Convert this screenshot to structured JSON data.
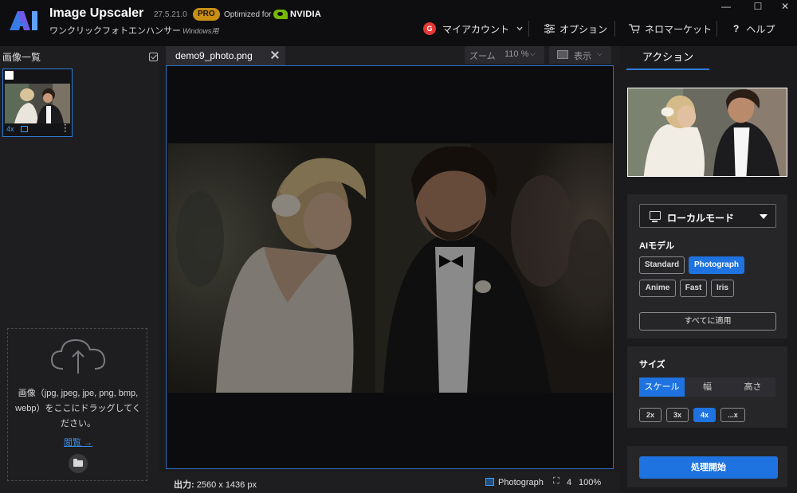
{
  "app": {
    "name": "Image Upscaler",
    "version": "27.5.21.0",
    "badge": "PRO",
    "optimized_for": "Optimized for",
    "optimized_brand": "NVIDIA",
    "subtitle": "ワンクリックフォトエンハンサー",
    "subtitle_os": "Windows用"
  },
  "window_controls": {
    "minimize": "—",
    "maximize": "☐",
    "close": "✕"
  },
  "topnav": {
    "account_initial": "G",
    "account": "マイアカウント",
    "options": "オプション",
    "market": "ネロマーケット",
    "help_glyph": "?",
    "help": "ヘルプ"
  },
  "left_panel": {
    "title": "画像一覧",
    "thumbnail": {
      "scale": "4x"
    },
    "dropzone": {
      "text": "画像（jpg, jpeg, jpe, png, bmp, webp）をここにドラッグしてください。",
      "browse": "閲覧 →"
    }
  },
  "tab": {
    "filename": "demo9_photo.png"
  },
  "zoom": {
    "label": "ズーム",
    "value": "110 %",
    "caret": "⌵"
  },
  "view": {
    "label": "表示",
    "caret": "⌵"
  },
  "status": {
    "output_label": "出力:",
    "output_value": "2560 x 1436 px",
    "model": "Photograph",
    "scale": "4",
    "zoom": "100%"
  },
  "right_panel": {
    "action_tab": "アクション",
    "mode": "ローカルモード",
    "ai_model_label": "AIモデル",
    "models": [
      "Standard",
      "Photograph",
      "Anime",
      "Fast",
      "Iris"
    ],
    "selected_model": "Photograph",
    "apply_all": "すべてに適用",
    "size_label": "サイズ",
    "size_modes": [
      "スケール",
      "幅",
      "高さ"
    ],
    "selected_size_mode": "スケール",
    "scales": [
      "2x",
      "3x",
      "4x",
      "...x"
    ],
    "selected_scale": "4x",
    "process": "処理開始"
  },
  "colors": {
    "accent": "#1e73e0",
    "pro_badge": "#c98f13",
    "nvidia_green": "#76b900",
    "link": "#3a8ee6"
  },
  "icons": [
    "app-logo-icon",
    "nvidia-logo-icon",
    "chevron-down-icon",
    "sliders-icon",
    "cart-icon",
    "help-icon",
    "checkbox-icon",
    "cloud-upload-icon",
    "folder-icon",
    "close-icon",
    "view-icon",
    "monitor-icon",
    "photo-icon",
    "expand-icon",
    "more-icon"
  ]
}
